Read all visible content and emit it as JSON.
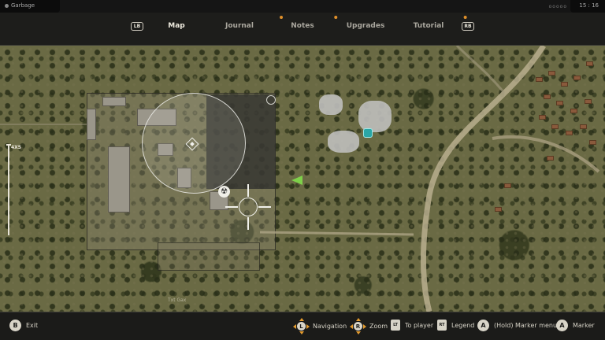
{
  "status": {
    "location": "Garbage",
    "dots": "ooooo",
    "time": "15 : 16"
  },
  "tabs": {
    "left_bumper": "LB",
    "right_bumper": "RB",
    "items": [
      {
        "label": "Map",
        "active": true,
        "new_indicator": false
      },
      {
        "label": "Journal",
        "active": false,
        "new_indicator": true
      },
      {
        "label": "Notes",
        "active": false,
        "new_indicator": true
      },
      {
        "label": "Upgrades",
        "active": false,
        "new_indicator": false
      },
      {
        "label": "Tutorial",
        "active": false,
        "new_indicator": true
      }
    ]
  },
  "map": {
    "zoom_label": "4X5",
    "place_label": "Txt Gax"
  },
  "icons": {
    "player_marker": "player-arrow-icon",
    "user_marker": "waypoint-diamond-icon",
    "radiation": "radiation-icon",
    "poi": "stash-icon",
    "cursor": "crosshair-icon"
  },
  "colors": {
    "accent": "#e0902a",
    "player": "#7ed04a",
    "poi": "#2aa6a6"
  },
  "controls": {
    "exit": {
      "key": "B",
      "label": "Exit"
    },
    "navigation": {
      "key": "L",
      "label": "Navigation"
    },
    "zoom": {
      "key": "R",
      "label": "Zoom"
    },
    "to_player": {
      "key": "LT",
      "label": "To player"
    },
    "legend": {
      "key": "RT",
      "label": "Legend"
    },
    "marker_menu": {
      "key": "A",
      "label": "(Hold) Marker menu"
    },
    "marker": {
      "key": "A",
      "label": "Marker"
    }
  }
}
